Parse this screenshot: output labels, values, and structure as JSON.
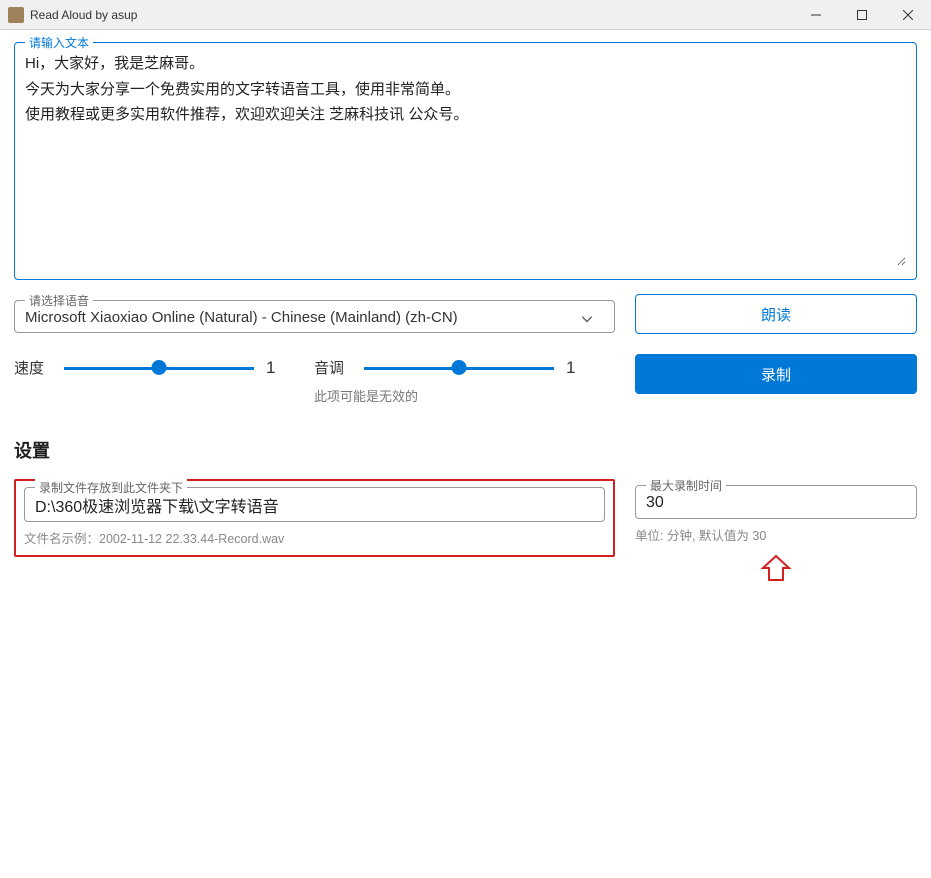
{
  "window": {
    "title": "Read Aloud by asup"
  },
  "textInput": {
    "legend": "请输入文本",
    "value": "Hi，大家好，我是芝麻哥。\n今天为大家分享一个免费实用的文字转语音工具，使用非常简单。\n使用教程或更多实用软件推荐，欢迎欢迎关注 芝麻科技讯 公众号。"
  },
  "voice": {
    "legend": "请选择语音",
    "selected": "Microsoft Xiaoxiao Online (Natural) - Chinese (Mainland) (zh-CN)"
  },
  "buttons": {
    "read": "朗读",
    "record": "录制"
  },
  "speed": {
    "label": "速度",
    "value": "1"
  },
  "pitch": {
    "label": "音调",
    "value": "1",
    "note": "此项可能是无效的"
  },
  "settings": {
    "title": "设置",
    "folder": {
      "legend": "录制文件存放到此文件夹下",
      "value": "D:\\360极速浏览器下载\\文字转语音",
      "helper": "文件名示例：2002-11-12 22.33.44-Record.wav"
    },
    "maxTime": {
      "legend": "最大录制时间",
      "value": "30",
      "helper": "单位: 分钟, 默认值为 30"
    }
  }
}
